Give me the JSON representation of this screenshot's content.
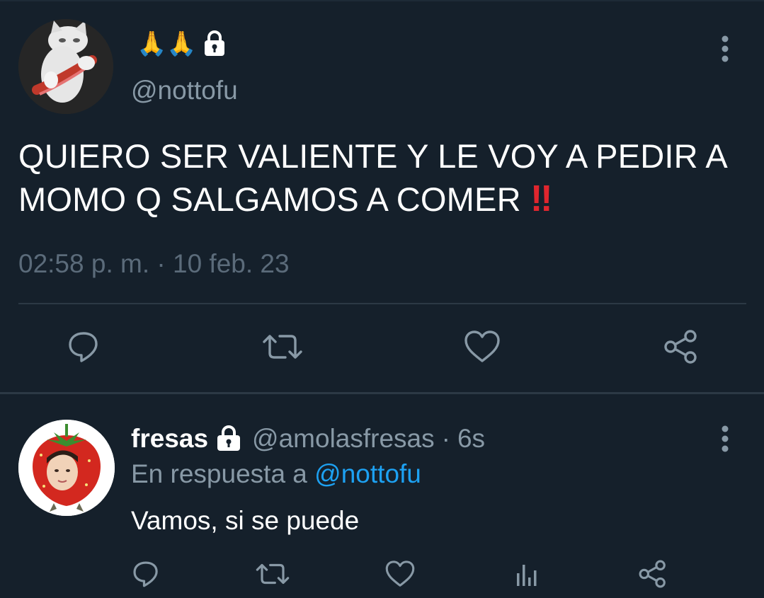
{
  "main_tweet": {
    "display_name": "🙏🙏",
    "handle": "@nottofu",
    "text": "QUIERO SER VALIENTE Y LE VOY A PEDIR A MOMO Q SALGAMOS A COMER",
    "text_emoji": "‼",
    "timestamp": "02:58 p. m. · 10 feb. 23",
    "icons": {
      "lock": "lock-icon",
      "more": "more-vertical-icon",
      "reply": "reply-icon",
      "retweet": "retweet-icon",
      "like": "heart-icon",
      "share": "share-icon"
    }
  },
  "reply_tweet": {
    "display_name": "fresas",
    "handle": "@amolasfresas",
    "separator": "·",
    "time": "6s",
    "reply_prefix": "En respuesta a",
    "reply_to": "@nottofu",
    "text": "Vamos, si se puede",
    "icons": {
      "lock": "lock-icon",
      "more": "more-vertical-icon",
      "reply": "reply-icon",
      "retweet": "retweet-icon",
      "like": "heart-icon",
      "analytics": "analytics-icon",
      "share": "share-icon"
    }
  },
  "colors": {
    "background": "#15202b",
    "primary_text": "#ffffff",
    "secondary_text": "#8899a6",
    "muted_text": "#5b6b7a",
    "link": "#1da1f2",
    "divider": "#2c3945",
    "icon": "#8899a6"
  }
}
